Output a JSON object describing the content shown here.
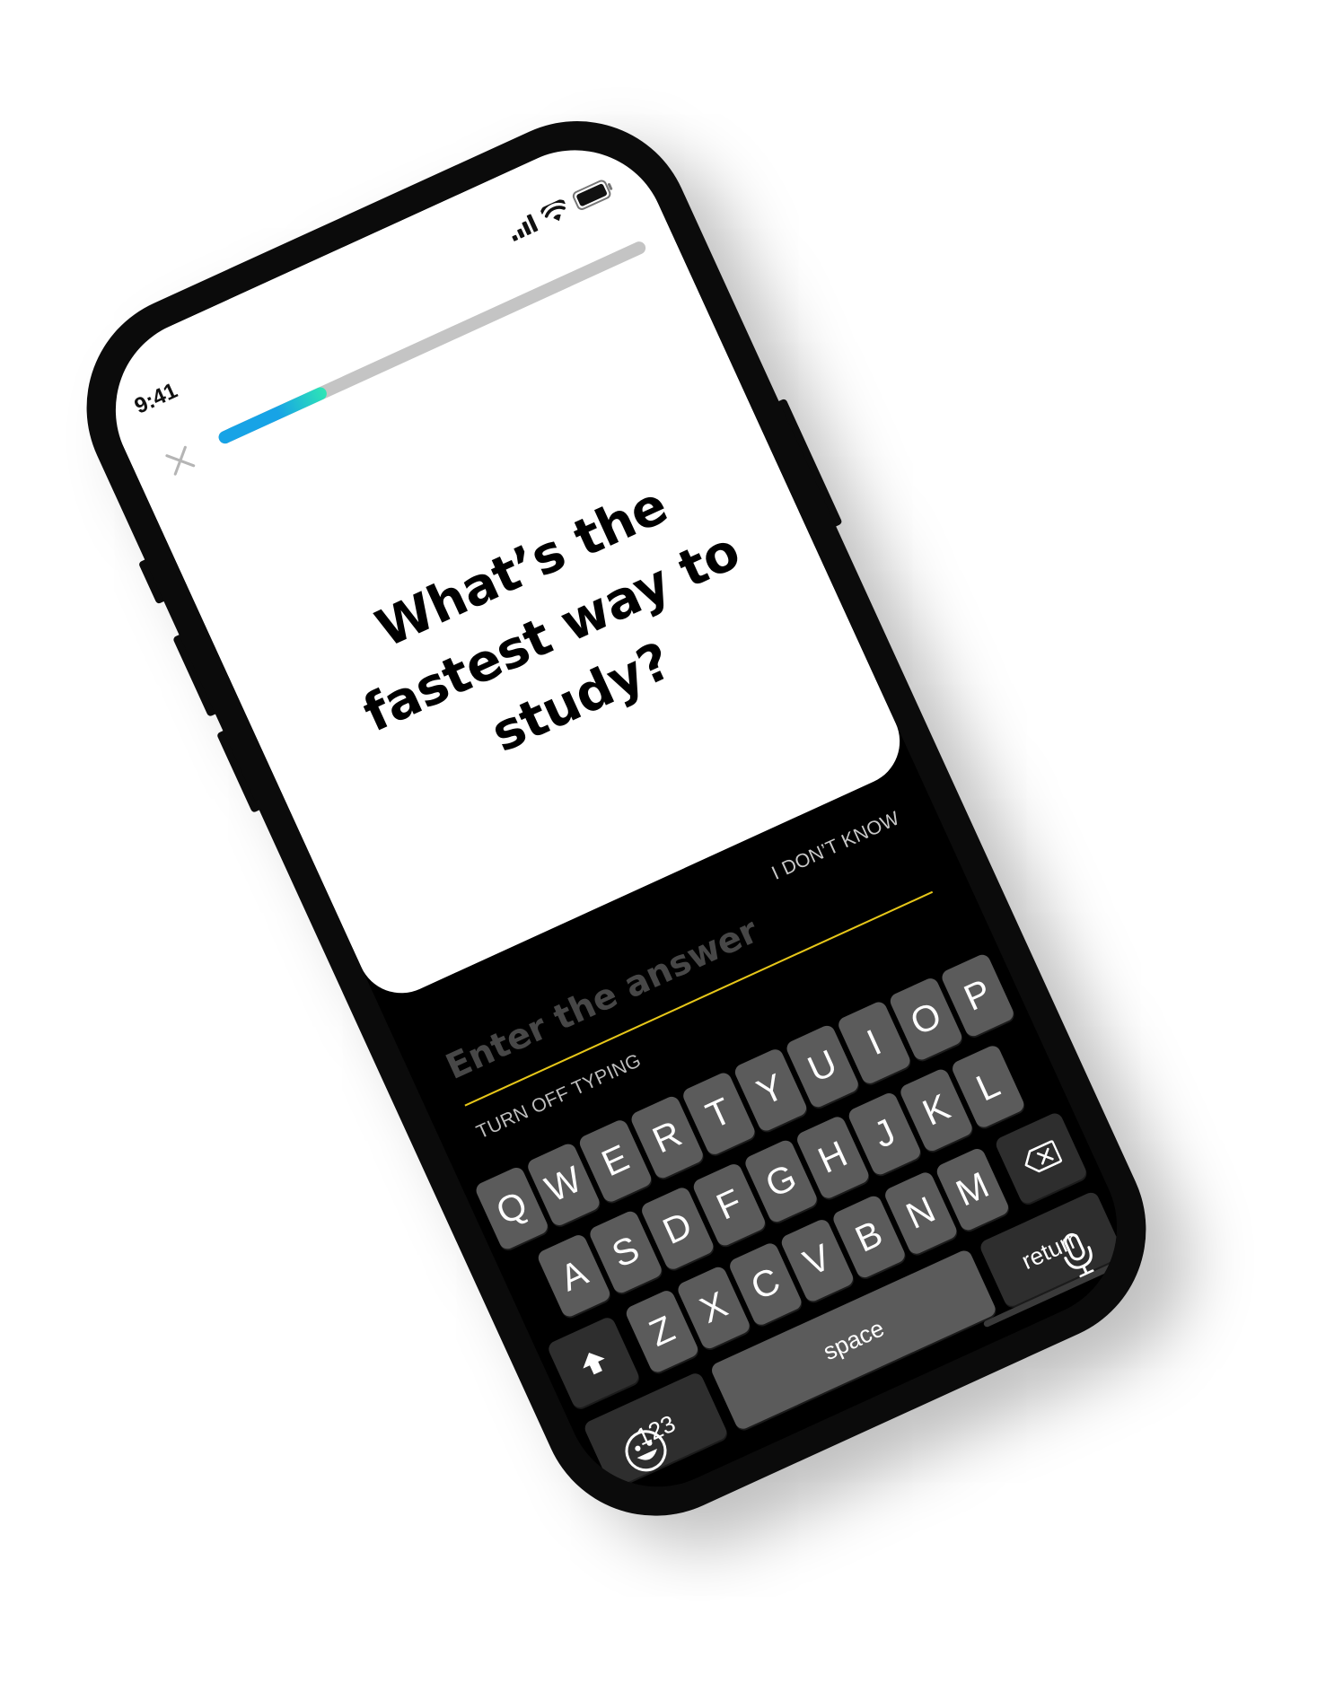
{
  "status_bar": {
    "time": "9:41",
    "signal_icon": "cellular-signal-icon",
    "wifi_icon": "wifi-icon",
    "battery_icon": "battery-icon"
  },
  "header": {
    "close_icon": "close-icon",
    "progress": 0.25,
    "progress_colors": [
      "#17a3e6",
      "#2ee6b5"
    ],
    "track_color": "#c4c4c4"
  },
  "card": {
    "question": "What’s the fastest way to study?"
  },
  "answer": {
    "placeholder": "Enter the answer",
    "dont_know": "I DON’T KNOW",
    "turn_off_typing": "TURN OFF TYPING",
    "underline_color": "#e6c619"
  },
  "keyboard": {
    "rows": [
      [
        "Q",
        "W",
        "E",
        "R",
        "T",
        "Y",
        "U",
        "I",
        "O",
        "P"
      ],
      [
        "A",
        "S",
        "D",
        "F",
        "G",
        "H",
        "J",
        "K",
        "L"
      ],
      [
        "Z",
        "X",
        "C",
        "V",
        "B",
        "N",
        "M"
      ]
    ],
    "shift_icon": "shift-arrow-icon",
    "backspace_icon": "backspace-icon",
    "numbers": "123",
    "space": "space",
    "return": "return",
    "emoji_icon": "emoji-icon",
    "mic_icon": "microphone-icon"
  }
}
